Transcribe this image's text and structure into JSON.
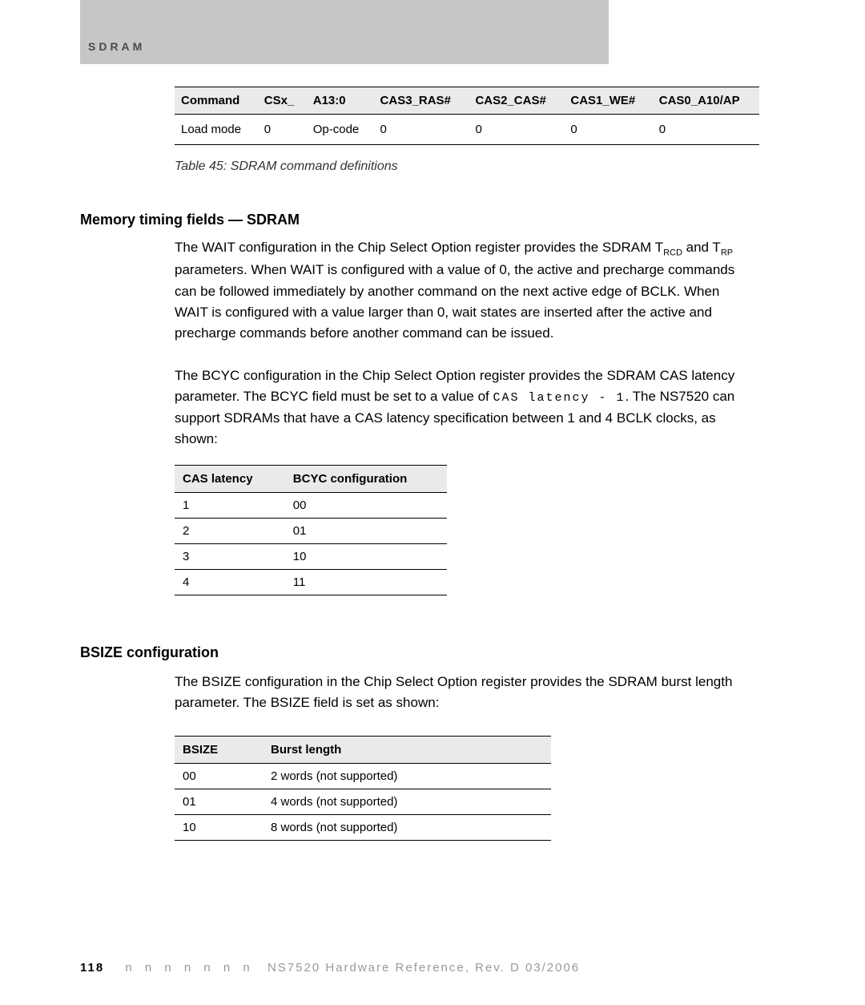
{
  "header": {
    "section_label": "SDRAM"
  },
  "table45": {
    "headers": [
      "Command",
      "CSx_",
      "A13:0",
      "CAS3_RAS#",
      "CAS2_CAS#",
      "CAS1_WE#",
      "CAS0_A10/AP"
    ],
    "row": [
      "Load mode",
      "0",
      "Op-code",
      "0",
      "0",
      "0",
      "0"
    ],
    "caption": "Table 45: SDRAM command definitions"
  },
  "section1": {
    "heading": "Memory timing fields — SDRAM",
    "para1_a": "The WAIT configuration in the Chip Select Option register provides the SDRAM T",
    "para1_sub1": "RCD",
    "para1_b": " and T",
    "para1_sub2": "RP",
    "para1_c": " parameters. When WAIT is configured with a value of 0, the active and precharge commands can be followed immediately by another command on the next active edge of BCLK. When WAIT is configured with a value larger than 0, wait states are inserted after the active and precharge commands before another command can be issued.",
    "para2_a": "The BCYC configuration in the Chip Select Option register provides the SDRAM CAS latency parameter. The BCYC field must be set to a value of ",
    "para2_code": "CAS latency - 1",
    "para2_b": ". The NS7520 can support SDRAMs that have a CAS latency specification between 1 and 4 BCLK clocks, as shown:"
  },
  "cas_table": {
    "headers": [
      "CAS latency",
      "BCYC configuration"
    ],
    "rows": [
      [
        "1",
        "00"
      ],
      [
        "2",
        "01"
      ],
      [
        "3",
        "10"
      ],
      [
        "4",
        "11"
      ]
    ]
  },
  "section2": {
    "heading": "BSIZE configuration",
    "para": "The BSIZE configuration in the Chip Select Option register provides the SDRAM burst length parameter. The BSIZE field is set as shown:"
  },
  "bsize_table": {
    "headers": [
      "BSIZE",
      "Burst length"
    ],
    "rows": [
      [
        "00",
        "2 words (not supported)"
      ],
      [
        "01",
        "4 words (not supported)"
      ],
      [
        "10",
        "8 words (not supported)"
      ]
    ]
  },
  "footer": {
    "page": "118",
    "dots": "n  n  n  n  n  n  n",
    "doc": "NS7520 Hardware Reference, Rev. D  03/2006"
  }
}
